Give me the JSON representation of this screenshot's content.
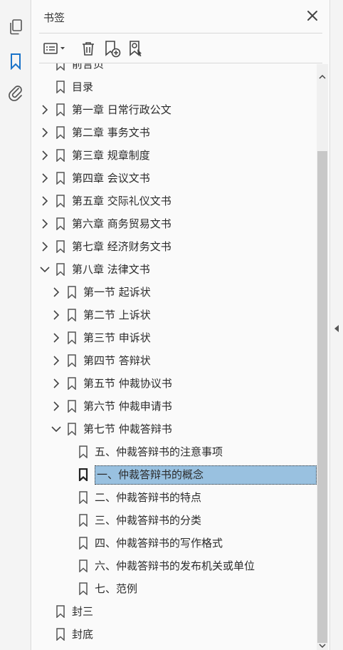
{
  "panel": {
    "title": "书签",
    "close_icon": "close-icon"
  },
  "left_rail": {
    "items": [
      {
        "name": "pages-icon",
        "active": false
      },
      {
        "name": "bookmark-icon",
        "active": true
      },
      {
        "name": "attachment-icon",
        "active": false
      }
    ]
  },
  "toolbar": {
    "buttons": [
      {
        "name": "options-menu-icon"
      },
      {
        "name": "delete-icon"
      },
      {
        "name": "new-bookmark-icon"
      },
      {
        "name": "find-bookmark-icon"
      }
    ]
  },
  "tree": {
    "partial_top_label": "前言页",
    "items": [
      {
        "label": "目录",
        "level": 0,
        "expander": "none"
      },
      {
        "label": "第一章 日常行政公文",
        "level": 0,
        "expander": "collapsed"
      },
      {
        "label": "第二章 事务文书",
        "level": 0,
        "expander": "collapsed"
      },
      {
        "label": "第三章 规章制度",
        "level": 0,
        "expander": "collapsed"
      },
      {
        "label": "第四章 会议文书",
        "level": 0,
        "expander": "collapsed"
      },
      {
        "label": "第五章 交际礼仪文书",
        "level": 0,
        "expander": "collapsed"
      },
      {
        "label": "第六章 商务贸易文书",
        "level": 0,
        "expander": "collapsed"
      },
      {
        "label": "第七章 经济财务文书",
        "level": 0,
        "expander": "collapsed"
      },
      {
        "label": "第八章 法律文书",
        "level": 0,
        "expander": "expanded"
      },
      {
        "label": "第一节 起诉状",
        "level": 1,
        "expander": "collapsed"
      },
      {
        "label": "第二节 上诉状",
        "level": 1,
        "expander": "collapsed"
      },
      {
        "label": "第三节 申诉状",
        "level": 1,
        "expander": "collapsed"
      },
      {
        "label": "第四节 答辩状",
        "level": 1,
        "expander": "collapsed"
      },
      {
        "label": "第五节 仲裁协议书",
        "level": 1,
        "expander": "collapsed"
      },
      {
        "label": "第六节 仲裁申请书",
        "level": 1,
        "expander": "collapsed"
      },
      {
        "label": "第七节 仲裁答辩书",
        "level": 1,
        "expander": "expanded"
      },
      {
        "label": "五、仲裁答辩书的注意事项",
        "level": 2,
        "expander": "none"
      },
      {
        "label": "一、仲裁答辩书的概念",
        "level": 2,
        "expander": "none",
        "selected": true
      },
      {
        "label": "二、仲裁答辩书的特点",
        "level": 2,
        "expander": "none"
      },
      {
        "label": "三、仲裁答辩书的分类",
        "level": 2,
        "expander": "none"
      },
      {
        "label": "四、仲裁答辩书的写作格式",
        "level": 2,
        "expander": "none"
      },
      {
        "label": "六、仲裁答辩书的发布机关或单位",
        "level": 2,
        "expander": "none"
      },
      {
        "label": "七、范例",
        "level": 2,
        "expander": "none"
      },
      {
        "label": "封三",
        "level": 0,
        "expander": "none"
      },
      {
        "label": "封底",
        "level": 0,
        "expander": "none"
      }
    ]
  },
  "colors": {
    "accent": "#1a73c9",
    "selection": "#99c1e0",
    "icon": "#555555"
  }
}
